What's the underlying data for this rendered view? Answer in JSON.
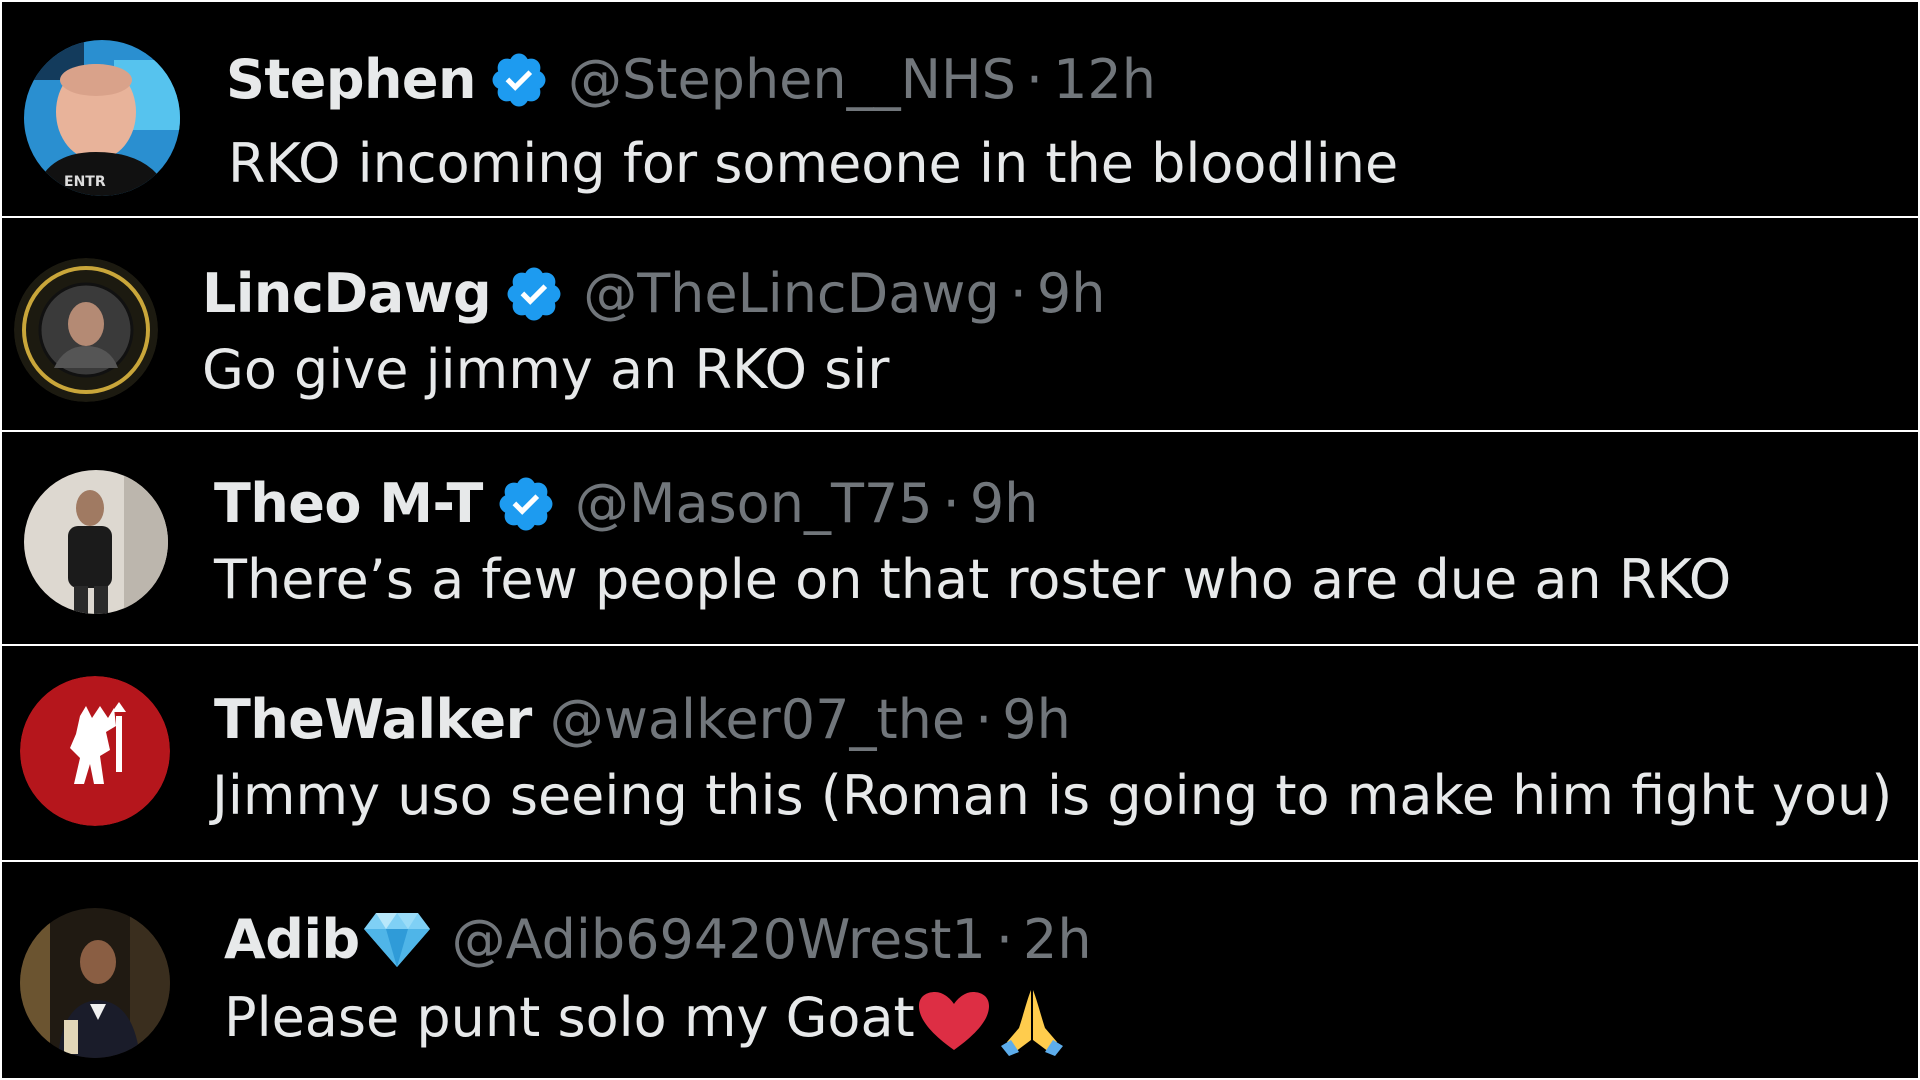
{
  "posts": [
    {
      "name": "Stephen",
      "verified": true,
      "handle": "@Stephen__NHS",
      "separator": "·",
      "time": "12h",
      "text": "RKO incoming for someone in the bloodline",
      "avatar_icon": "profile-photo-man-black-shirt"
    },
    {
      "name": "LincDawg",
      "verified": true,
      "handle": "@TheLincDawg",
      "separator": "·",
      "time": "9h",
      "text": "Go give jimmy an RKO sir",
      "avatar_icon": "profile-photo-circular-badge"
    },
    {
      "name": "Theo M-T",
      "verified": true,
      "handle": "@Mason_T75",
      "separator": "·",
      "time": "9h",
      "text": "There’s a few people on that roster who are due an RKO",
      "avatar_icon": "profile-photo-mirror-selfie"
    },
    {
      "name": "TheWalker",
      "verified": false,
      "handle": "@walker07_the",
      "separator": "·",
      "time": "9h",
      "text": "Jimmy uso seeing this (Roman is going to make him fight you)",
      "avatar_icon": "red-devil-crest"
    },
    {
      "name": "Adib",
      "verified": false,
      "name_emoji": "gem-icon",
      "handle": "@Adib69420Wrest1",
      "separator": "·",
      "time": "2h",
      "text": "Please punt solo my Goat",
      "text_emojis": [
        "red-heart-icon",
        "folded-hands-icon"
      ],
      "avatar_icon": "profile-photo-man-tuxedo"
    }
  ],
  "colors": {
    "background": "#000000",
    "divider": "#ffffff",
    "primary_text": "#e7e9ea",
    "secondary_text": "#71767b",
    "verified_blue": "#1d9bf0"
  }
}
